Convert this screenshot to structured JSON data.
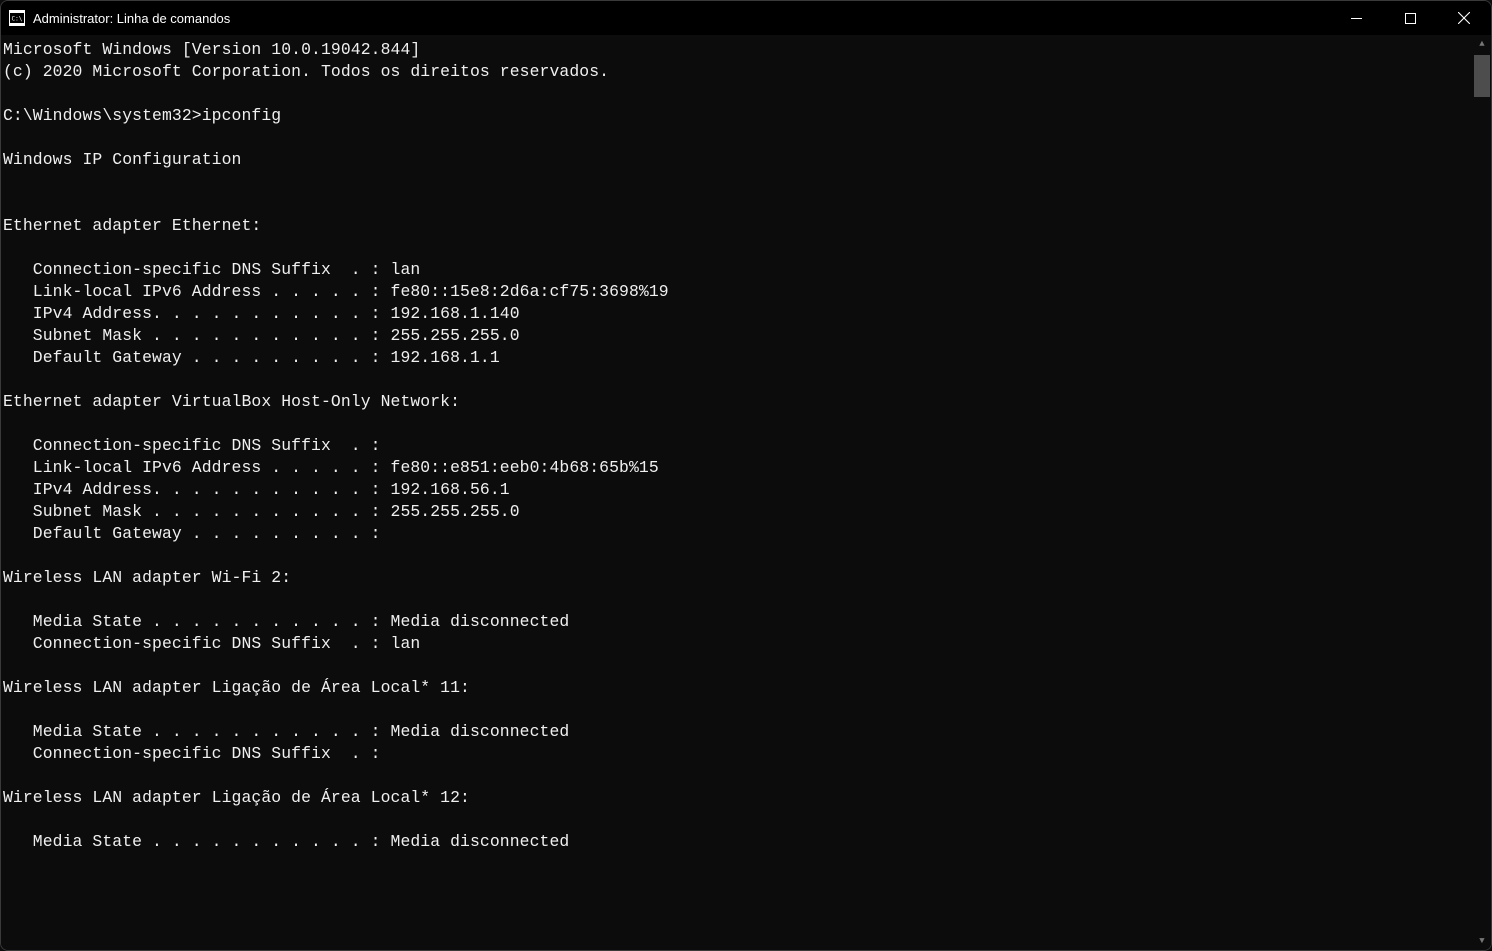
{
  "window": {
    "title": "Administrator: Linha de comandos"
  },
  "terminal": {
    "lines": [
      "Microsoft Windows [Version 10.0.19042.844]",
      "(c) 2020 Microsoft Corporation. Todos os direitos reservados.",
      "",
      "C:\\Windows\\system32>ipconfig",
      "",
      "Windows IP Configuration",
      "",
      "",
      "Ethernet adapter Ethernet:",
      "",
      "   Connection-specific DNS Suffix  . : lan",
      "   Link-local IPv6 Address . . . . . : fe80::15e8:2d6a:cf75:3698%19",
      "   IPv4 Address. . . . . . . . . . . : 192.168.1.140",
      "   Subnet Mask . . . . . . . . . . . : 255.255.255.0",
      "   Default Gateway . . . . . . . . . : 192.168.1.1",
      "",
      "Ethernet adapter VirtualBox Host-Only Network:",
      "",
      "   Connection-specific DNS Suffix  . :",
      "   Link-local IPv6 Address . . . . . : fe80::e851:eeb0:4b68:65b%15",
      "   IPv4 Address. . . . . . . . . . . : 192.168.56.1",
      "   Subnet Mask . . . . . . . . . . . : 255.255.255.0",
      "   Default Gateway . . . . . . . . . :",
      "",
      "Wireless LAN adapter Wi-Fi 2:",
      "",
      "   Media State . . . . . . . . . . . : Media disconnected",
      "   Connection-specific DNS Suffix  . : lan",
      "",
      "Wireless LAN adapter Ligação de Área Local* 11:",
      "",
      "   Media State . . . . . . . . . . . : Media disconnected",
      "   Connection-specific DNS Suffix  . :",
      "",
      "Wireless LAN adapter Ligação de Área Local* 12:",
      "",
      "   Media State . . . . . . . . . . . : Media disconnected"
    ]
  }
}
